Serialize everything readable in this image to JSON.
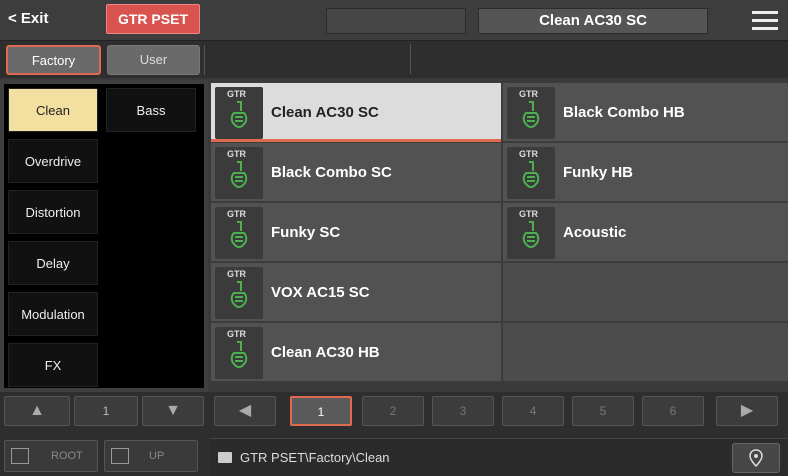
{
  "header": {
    "exit_label": "< Exit",
    "mode_label": "GTR PSET",
    "selected_title": "Clean AC30 SC",
    "menu_icon": "hamburger-menu-icon"
  },
  "tabs": {
    "factory_label": "Factory",
    "user_label": "User",
    "active": "Factory"
  },
  "categories": [
    {
      "label": "Clean",
      "selected": true
    },
    {
      "label": "Bass",
      "selected": false
    },
    {
      "label": "Overdrive",
      "selected": false
    },
    {
      "label": "Distortion",
      "selected": false
    },
    {
      "label": "Delay",
      "selected": false
    },
    {
      "label": "Modulation",
      "selected": false
    },
    {
      "label": "FX",
      "selected": false
    }
  ],
  "presets": [
    {
      "tag": "GTR",
      "name": "Clean AC30 SC",
      "selected": true
    },
    {
      "tag": "GTR",
      "name": "Black Combo HB",
      "selected": false
    },
    {
      "tag": "GTR",
      "name": "Black Combo SC",
      "selected": false
    },
    {
      "tag": "GTR",
      "name": "Funky HB",
      "selected": false
    },
    {
      "tag": "GTR",
      "name": "Funky SC",
      "selected": false
    },
    {
      "tag": "GTR",
      "name": "Acoustic",
      "selected": false
    },
    {
      "tag": "GTR",
      "name": "VOX AC15 SC",
      "selected": false
    },
    {
      "tag": "",
      "name": "",
      "selected": false
    },
    {
      "tag": "GTR",
      "name": "Clean AC30 HB",
      "selected": false
    },
    {
      "tag": "",
      "name": "",
      "selected": false
    }
  ],
  "category_pager": {
    "up_icon": "triangle-up-icon",
    "down_icon": "triangle-down-icon",
    "page": "1"
  },
  "pages": {
    "prev_icon": "triangle-left-icon",
    "next_icon": "triangle-right-icon",
    "items": [
      "1",
      "2",
      "3",
      "4",
      "5",
      "6"
    ],
    "current": "1"
  },
  "nav": {
    "root_label": "ROOT",
    "up_label": "UP",
    "root_icon": "home-folder-icon",
    "up_icon": "up-folder-icon"
  },
  "path": {
    "text": "GTR PSET\\Factory\\Clean",
    "folder_icon": "folder-icon",
    "pin_icon": "location-pin-icon"
  },
  "colors": {
    "accent": "#e06a4f",
    "mode_badge": "#d9534f",
    "selected_category": "#f3e0a0",
    "guitar_icon": "#4caf50"
  }
}
